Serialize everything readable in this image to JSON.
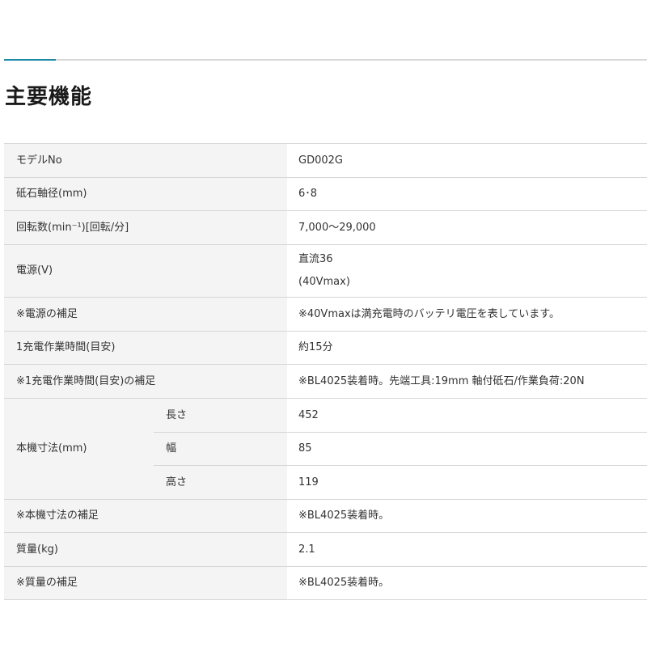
{
  "section": {
    "title": "主要機能"
  },
  "colors": {
    "accent": "#1e8aa6",
    "label_bg": "#f4f4f4",
    "border": "#d6d6d6"
  },
  "specs": {
    "model": {
      "label": "モデルNo",
      "value": "GD002G"
    },
    "shaft": {
      "label": "砥石軸径(mm)",
      "value": "6･8"
    },
    "rpm": {
      "label": "回転数(min⁻¹)[回転/分]",
      "value": "7,000～29,000"
    },
    "power": {
      "label": "電源(V)",
      "value_line1": "直流36",
      "value_line2": "(40Vmax)"
    },
    "power_note": {
      "label": "※電源の補足",
      "value": "※40Vmaxは満充電時のバッテリ電圧を表しています。"
    },
    "runtime": {
      "label": "1充電作業時間(目安)",
      "value": "約15分"
    },
    "runtime_note": {
      "label": "※1充電作業時間(目安)の補足",
      "value": "※BL4025装着時。先端工具:19mm 軸付砥石/作業負荷:20N"
    },
    "dimensions": {
      "label": "本機寸法(mm)",
      "length": {
        "label": "長さ",
        "value": "452"
      },
      "width": {
        "label": "幅",
        "value": "85"
      },
      "height": {
        "label": "高さ",
        "value": "119"
      }
    },
    "dimensions_note": {
      "label": "※本機寸法の補足",
      "value": "※BL4025装着時。"
    },
    "mass": {
      "label": "質量(kg)",
      "value": "2.1"
    },
    "mass_note": {
      "label": "※質量の補足",
      "value": "※BL4025装着時。"
    }
  }
}
